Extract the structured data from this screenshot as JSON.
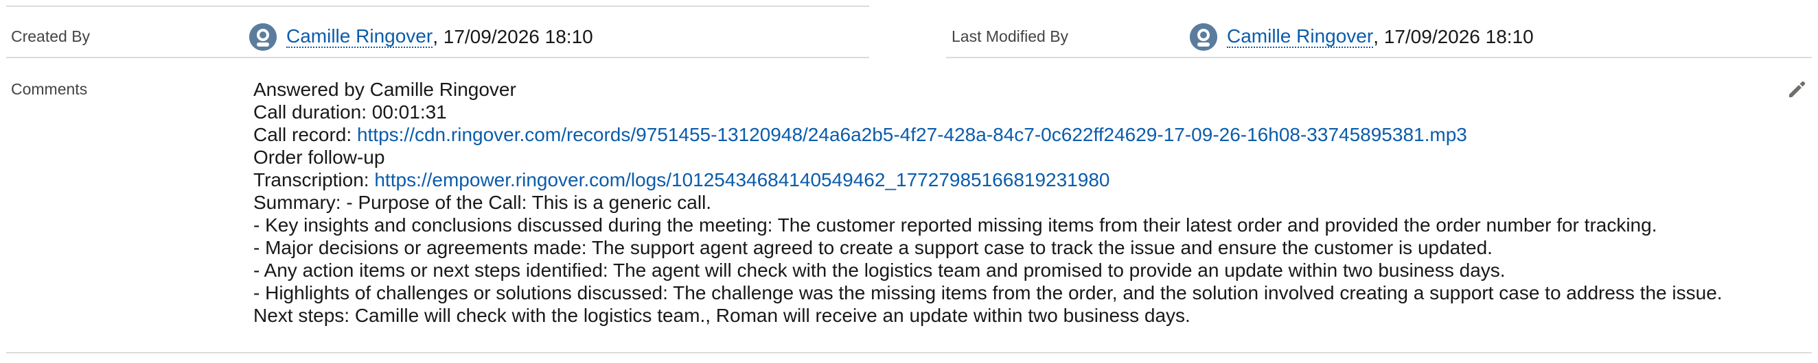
{
  "created": {
    "label": "Created By",
    "user": "Camille Ringover",
    "date": ", 17/09/2026 18:10"
  },
  "modified": {
    "label": "Last Modified By",
    "user": "Camille Ringover",
    "date": ", 17/09/2026 18:10"
  },
  "comments": {
    "label": "Comments",
    "line1": "Answered by Camille Ringover",
    "line2": "Call duration: 00:01:31",
    "record_prefix": "Call record: ",
    "record_url": "https://cdn.ringover.com/records/9751455-13120948/24a6a2b5-4f27-428a-84c7-0c622ff24629-17-09-26-16h08-33745895381.mp3",
    "line4": "Order follow-up",
    "transcription_prefix": "Transcription: ",
    "transcription_url": "https://empower.ringover.com/logs/10125434684140549462_17727985166819231980",
    "summary1": "Summary: - Purpose of the Call: This is a generic call.",
    "summary2": "- Key insights and conclusions discussed during the meeting: The customer reported missing items from their latest order and provided the order number for tracking.",
    "summary3": "- Major decisions or agreements made: The support agent agreed to create a support case to track the issue and ensure the customer is updated.",
    "summary4": "- Any action items or next steps identified: The agent will check with the logistics team and promised to provide an update within two business days.",
    "summary5": "- Highlights of challenges or solutions discussed: The challenge was the missing items from the order, and the solution involved creating a support case to address the issue.",
    "next_steps": "Next steps: Camille will check with the logistics team., Roman will receive an update within two business days."
  },
  "icons": {
    "avatar": "user-avatar-icon",
    "edit": "pencil-edit-icon"
  }
}
